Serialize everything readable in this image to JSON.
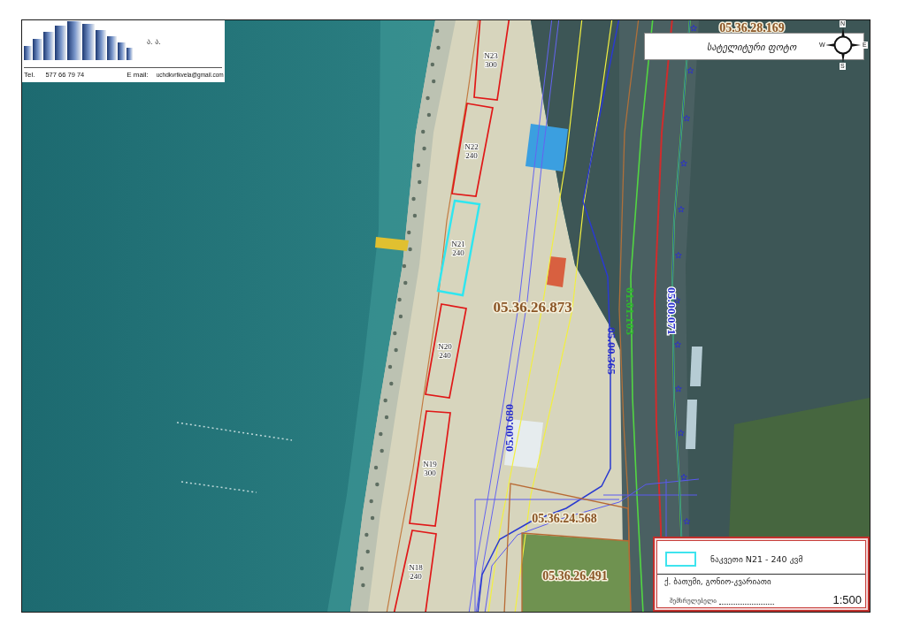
{
  "header": {
    "initials": "ა. ა.",
    "phone_label": "Tel.",
    "phone": "577 66 79 74",
    "email_label": "E mail:",
    "email": "uchdkvrtkvela@gmail.com"
  },
  "title": "სატელიტური ფოტო",
  "compass": {
    "north": "N",
    "east": "E",
    "south": "S",
    "west": "W"
  },
  "map": {
    "cadastral_codes": [
      "05.36.28.169",
      "05.36.26.873",
      "05.36.24.568",
      "05.36.26.491"
    ],
    "road_codes": [
      {
        "text": "05.00.680",
        "kind": "road"
      },
      {
        "text": "05.00.365",
        "kind": "road"
      },
      {
        "text": "01.01.103",
        "kind": "network"
      },
      {
        "text": "05.00.071",
        "kind": "highway"
      }
    ],
    "parcels": [
      {
        "number": "N23",
        "area": "300",
        "selected": false
      },
      {
        "number": "N22",
        "area": "240",
        "selected": false
      },
      {
        "number": "N21",
        "area": "240",
        "selected": true
      },
      {
        "number": "N20",
        "area": "240",
        "selected": false
      },
      {
        "number": "N19",
        "area": "300",
        "selected": false
      },
      {
        "number": "N18",
        "area": "240",
        "selected": false
      }
    ]
  },
  "legend": {
    "items": [
      {
        "label": "ნაკვეთი N21 - 240 კვმ"
      }
    ],
    "address": "ქ. ბათუმი, გონიო-კვარიათი",
    "signature_label": "შემსრულებელი",
    "scale": "1:500"
  }
}
